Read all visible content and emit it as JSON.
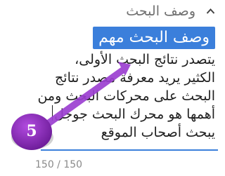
{
  "section": {
    "title": "وصف البحث"
  },
  "editor": {
    "heading": "وصف البحث مهم",
    "lines": [
      "يتصدر نتائج البحث الأولى،",
      "الكثير يريد معرفة مصدر نتائج",
      "البحث على محركات البحث ومن",
      "أهمها هو محرك البحث جوجل",
      "يبحث أصحاب الموقع"
    ]
  },
  "counter": {
    "text": "150 / 150"
  },
  "annotation": {
    "step_number": "5"
  },
  "colors": {
    "accent": "#3b7fdb",
    "badge": "#8a2bb8",
    "arrow": "#9b3fd0"
  }
}
